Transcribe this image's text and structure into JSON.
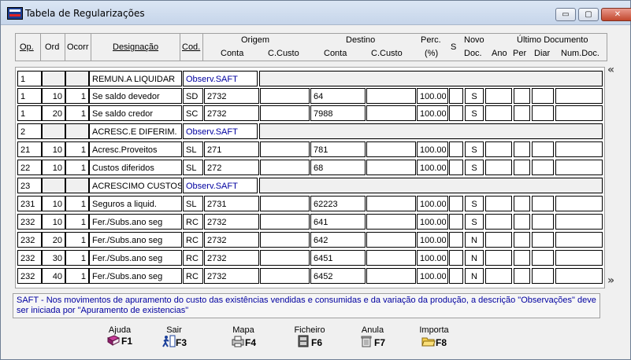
{
  "window": {
    "title": "Tabela de Regularizações",
    "buttons": {
      "minimize": "▭",
      "maximize": "▢",
      "close": "✕"
    }
  },
  "header": {
    "op": "Op.",
    "ord": "Ord",
    "ocorr": "Ocorr",
    "designacao": "Designação",
    "cod": "Cod.",
    "origem": "Origem",
    "origem_conta": "Conta",
    "origem_ccusto": "C.Custo",
    "destino": "Destino",
    "destino_conta": "Conta",
    "destino_ccusto": "C.Custo",
    "perc": "Perc.",
    "perc_unit": "(%)",
    "s": "S",
    "novo": "Novo",
    "novo_doc": "Doc.",
    "ultimo_documento": "Último Documento",
    "ano": "Ano",
    "per": "Per",
    "diar": "Diar",
    "num_doc": "Num.Doc."
  },
  "rows": [
    {
      "type": "group",
      "op": "1",
      "designacao": "REMUN.A LIQUIDAR",
      "obs": "Observ.SAFT"
    },
    {
      "type": "line",
      "op": "1",
      "ord": "10",
      "ocorr": "1",
      "designacao": "Se saldo devedor",
      "cod": "SD",
      "origem_conta": "2732",
      "origem_ccusto": "",
      "destino_conta": "64",
      "destino_ccusto": "",
      "perc": "100.00",
      "s": "",
      "novo_doc": "S"
    },
    {
      "type": "line",
      "op": "1",
      "ord": "20",
      "ocorr": "1",
      "designacao": "Se saldo credor",
      "cod": "SC",
      "origem_conta": "2732",
      "origem_ccusto": "",
      "destino_conta": "7988",
      "destino_ccusto": "",
      "perc": "100.00",
      "s": "",
      "novo_doc": "S"
    },
    {
      "type": "group",
      "op": "2",
      "designacao": "ACRESC.E DIFERIM.",
      "obs": "Observ.SAFT"
    },
    {
      "type": "line",
      "op": "21",
      "ord": "10",
      "ocorr": "1",
      "designacao": "Acresc.Proveitos",
      "cod": "SL",
      "origem_conta": "271",
      "origem_ccusto": "",
      "destino_conta": "781",
      "destino_ccusto": "",
      "perc": "100.00",
      "s": "",
      "novo_doc": "S"
    },
    {
      "type": "line",
      "op": "22",
      "ord": "10",
      "ocorr": "1",
      "designacao": "Custos diferidos",
      "cod": "SL",
      "origem_conta": "272",
      "origem_ccusto": "",
      "destino_conta": "68",
      "destino_ccusto": "",
      "perc": "100.00",
      "s": "",
      "novo_doc": "S"
    },
    {
      "type": "group",
      "op": "23",
      "designacao": "ACRESCIMO CUSTOS",
      "obs": "Observ.SAFT"
    },
    {
      "type": "line",
      "op": "231",
      "ord": "10",
      "ocorr": "1",
      "designacao": "Seguros a liquid.",
      "cod": "SL",
      "origem_conta": "2731",
      "origem_ccusto": "",
      "destino_conta": "62223",
      "destino_ccusto": "",
      "perc": "100.00",
      "s": "",
      "novo_doc": "S"
    },
    {
      "type": "line",
      "op": "232",
      "ord": "10",
      "ocorr": "1",
      "designacao": "Fer./Subs.ano seg",
      "cod": "RC",
      "origem_conta": "2732",
      "origem_ccusto": "",
      "destino_conta": "641",
      "destino_ccusto": "",
      "perc": "100.00",
      "s": "",
      "novo_doc": "S"
    },
    {
      "type": "line",
      "op": "232",
      "ord": "20",
      "ocorr": "1",
      "designacao": "Fer./Subs.ano seg",
      "cod": "RC",
      "origem_conta": "2732",
      "origem_ccusto": "",
      "destino_conta": "642",
      "destino_ccusto": "",
      "perc": "100.00",
      "s": "",
      "novo_doc": "N"
    },
    {
      "type": "line",
      "op": "232",
      "ord": "30",
      "ocorr": "1",
      "designacao": "Fer./Subs.ano seg",
      "cod": "RC",
      "origem_conta": "2732",
      "origem_ccusto": "",
      "destino_conta": "6451",
      "destino_ccusto": "",
      "perc": "100.00",
      "s": "",
      "novo_doc": "N"
    },
    {
      "type": "line",
      "op": "232",
      "ord": "40",
      "ocorr": "1",
      "designacao": "Fer./Subs.ano seg",
      "cod": "RC",
      "origem_conta": "2732",
      "origem_ccusto": "",
      "destino_conta": "6452",
      "destino_ccusto": "",
      "perc": "100.00",
      "s": "",
      "novo_doc": "N"
    }
  ],
  "nav": {
    "prev": "«",
    "next": "»"
  },
  "note": "SAFT - Nos movimentos de apuramento do custo das existências vendidas e consumidas e da variação da produção, a descrição \"Observações\" deve ser iniciada por \"Apuramento de existencias\"",
  "fkeys": [
    {
      "label": "Ajuda",
      "key": "F1",
      "icon": "book-icon",
      "color": "#b0308a"
    },
    {
      "label": "Sair",
      "key": "F3",
      "icon": "exit-icon",
      "color": "#1a3f9a"
    },
    {
      "label": "Mapa",
      "key": "F4",
      "icon": "printer-icon",
      "color": "#707070"
    },
    {
      "label": "Ficheiro",
      "key": "F6",
      "icon": "file-cabinet-icon",
      "color": "#303030"
    },
    {
      "label": "Anula",
      "key": "F7",
      "icon": "trash-icon",
      "color": "#909090"
    },
    {
      "label": "Importa",
      "key": "F8",
      "icon": "folder-icon",
      "color": "#e0b020"
    }
  ]
}
